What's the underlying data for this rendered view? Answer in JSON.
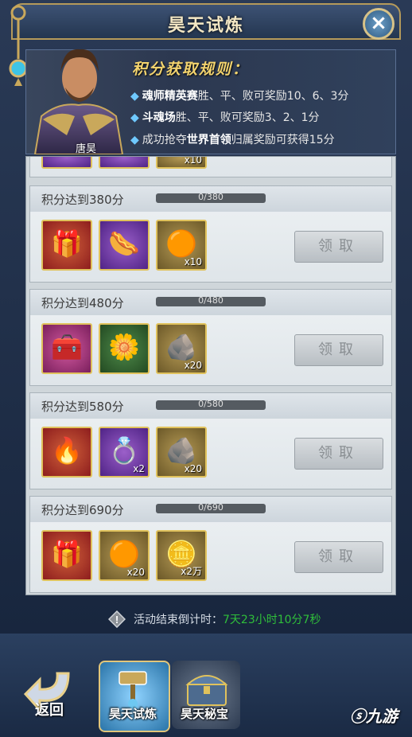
{
  "window": {
    "title": "昊天试炼",
    "close_icon": "close-icon"
  },
  "rules": {
    "hero_name": "唐昊",
    "title": "积分获取规则：",
    "lines": [
      {
        "highlight": "魂师精英赛",
        "text": "胜、平、败可奖励10、6、3分"
      },
      {
        "highlight": "斗魂场",
        "text": "胜、平、败可奖励3、2、1分"
      },
      {
        "prefix": "成功抢夺",
        "highlight": "世界首领",
        "text": "归属奖励可获得15分"
      }
    ]
  },
  "rewards": [
    {
      "label": "积分达到380分",
      "progress": "0/380",
      "progress_value": 0,
      "items": [
        {
          "icon": "gift-box-icon",
          "count": ""
        },
        {
          "icon": "sausage-icon",
          "count": ""
        },
        {
          "icon": "amber-stone-icon",
          "count": "x10"
        }
      ],
      "claim": "领取"
    },
    {
      "label": "积分达到480分",
      "progress": "0/480",
      "progress_value": 0,
      "items": [
        {
          "icon": "treasure-chest-icon",
          "count": ""
        },
        {
          "icon": "flower-herb-icon",
          "count": ""
        },
        {
          "icon": "silver-ore-icon",
          "count": "x20"
        }
      ],
      "claim": "领取"
    },
    {
      "label": "积分达到580分",
      "progress": "0/580",
      "progress_value": 0,
      "items": [
        {
          "icon": "fire-orb-icon",
          "count": ""
        },
        {
          "icon": "blue-ring-icon",
          "count": "x2"
        },
        {
          "icon": "silver-ore-icon",
          "count": "x20"
        }
      ],
      "claim": "领取"
    },
    {
      "label": "积分达到690分",
      "progress": "0/690",
      "progress_value": 0,
      "items": [
        {
          "icon": "gift-box-icon",
          "count": ""
        },
        {
          "icon": "amber-stone-icon",
          "count": "x20"
        },
        {
          "icon": "gold-coin-icon",
          "count": "x2万"
        }
      ],
      "claim": "领取"
    }
  ],
  "partial_top_item_count": "x10",
  "timer": {
    "label": "活动结束倒计时：",
    "value": "7天23小时10分7秒"
  },
  "bottom": {
    "back_label": "返回",
    "tabs": [
      {
        "label": "昊天试炼",
        "active": true
      },
      {
        "label": "昊天秘宝",
        "active": false
      }
    ],
    "watermark": "九游"
  }
}
